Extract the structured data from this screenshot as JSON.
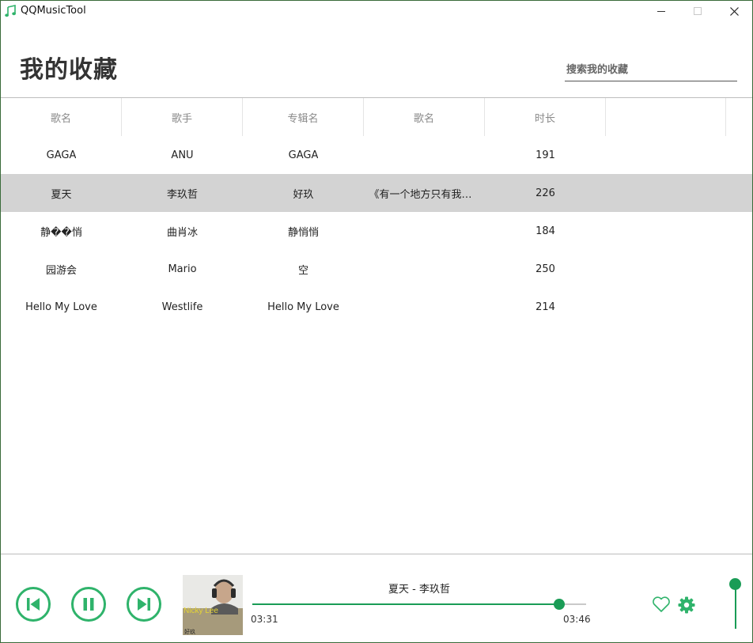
{
  "window": {
    "title": "QQMusicTool"
  },
  "header": {
    "title": "我的收藏"
  },
  "search": {
    "placeholder": "搜索我的收藏",
    "value": ""
  },
  "table": {
    "columns": [
      "歌名",
      "歌手",
      "专辑名",
      "歌名",
      "时长",
      ""
    ],
    "rows": [
      [
        "GAGA",
        "ANU",
        "GAGA",
        "",
        "191"
      ],
      [
        "夏天",
        "李玖哲",
        "好玖",
        "《有一个地方只有我们知...",
        "226"
      ],
      [
        "静��悄",
        "曲肖冰",
        "静悄悄",
        "",
        "184"
      ],
      [
        "园游会",
        "Mario",
        "空",
        "",
        "250"
      ],
      [
        "Hello My Love",
        "Westlife",
        "Hello My Love",
        "",
        "214"
      ]
    ],
    "selected_row": 1
  },
  "player": {
    "now_playing": "夏天 - 李玖哲",
    "current_time": "03:31",
    "total_time": "03:46",
    "progress": 0.92,
    "volume": 1.0,
    "cover": {
      "artist_text": "Nicky Lee",
      "album_text": "好玖"
    },
    "icons": {
      "prev": "skip-previous-icon",
      "pause": "pause-icon",
      "next": "skip-next-icon",
      "favorite": "heart-icon",
      "settings": "gear-icon"
    }
  },
  "colors": {
    "accent": "#1a9c56",
    "button_ring": "#2fb36b",
    "selected_row": "#d3d3d3"
  }
}
